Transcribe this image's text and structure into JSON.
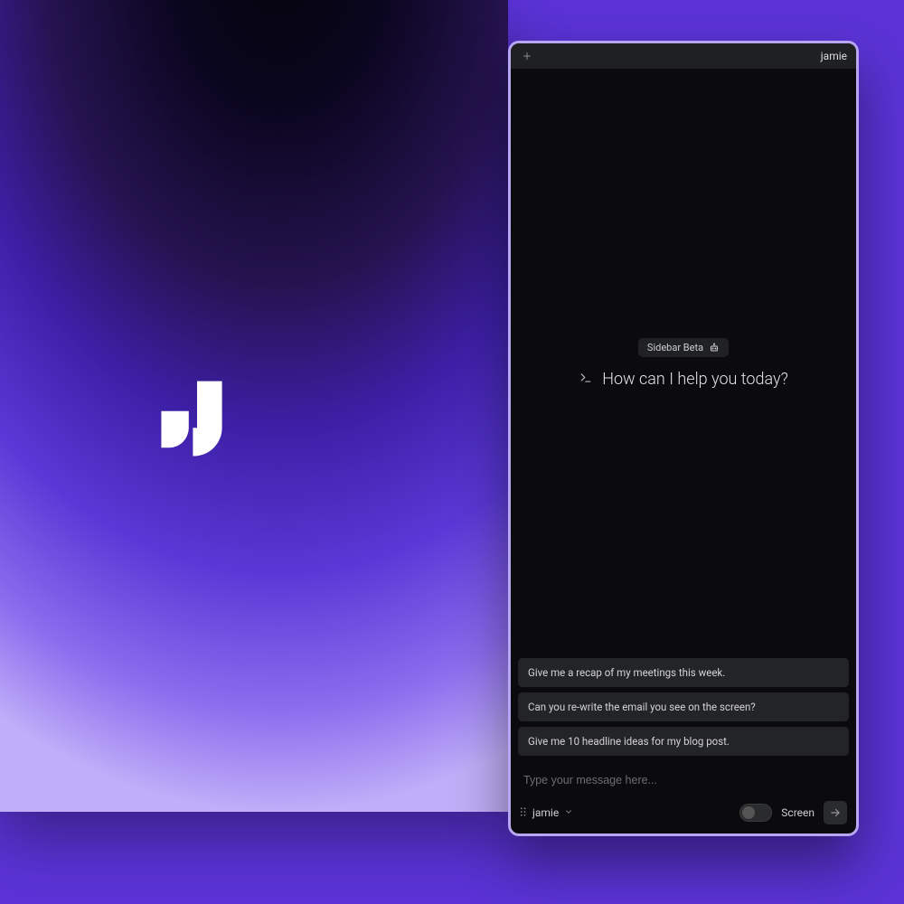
{
  "brand": {
    "logo_name": "jamie-logo"
  },
  "sidebar": {
    "titlebar": {
      "title": "jamie"
    },
    "badge": {
      "label": "Sidebar Beta"
    },
    "greeting": "How can I help you today?",
    "suggestions": [
      "Give me a recap of my meetings this week.",
      "Can you re-write the email you see on the screen?",
      "Give me 10 headline ideas for my blog post."
    ],
    "input": {
      "placeholder": "Type your message here..."
    },
    "model": {
      "name": "jamie"
    },
    "screen_toggle": {
      "label": "Screen",
      "on": false
    }
  },
  "colors": {
    "accent_border": "#b8a6f2",
    "panel_bg": "#0b0b0d"
  }
}
